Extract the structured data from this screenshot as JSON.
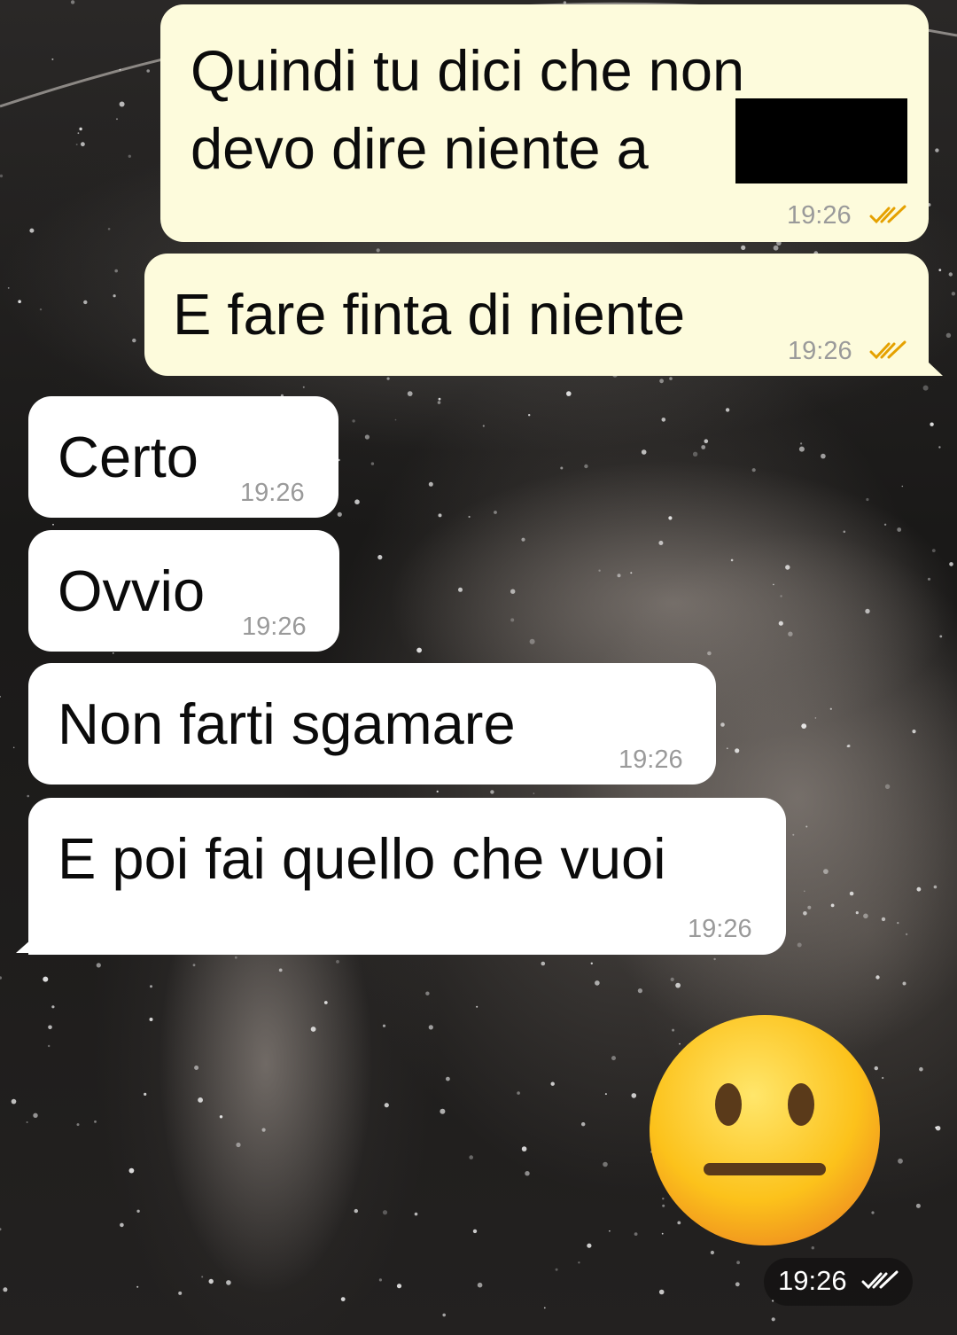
{
  "theme": {
    "outgoing_bubble_color": "#fdfbdc",
    "incoming_bubble_color": "#ffffff",
    "read_ticks_color": "#e5a100",
    "time_color": "#9a9a9a"
  },
  "messages": [
    {
      "direction": "outgoing",
      "lines": [
        "Quindi tu dici che non",
        "devo dire niente a"
      ],
      "redacted": true,
      "time": "19:26",
      "status_icon": "double-check-read-icon"
    },
    {
      "direction": "outgoing",
      "text": "E fare finta di niente",
      "time": "19:26",
      "status_icon": "double-check-read-icon"
    },
    {
      "direction": "incoming",
      "text": "Certo",
      "time": "19:26"
    },
    {
      "direction": "incoming",
      "text": "Ovvio",
      "time": "19:26"
    },
    {
      "direction": "incoming",
      "text": "Non farti sgamare",
      "time": "19:26"
    },
    {
      "direction": "incoming",
      "text": "E poi fai quello che vuoi",
      "time": "19:26"
    },
    {
      "direction": "outgoing",
      "emoji": "neutral-face-emoji",
      "time": "19:26",
      "status_icon": "double-check-delivered-icon"
    }
  ]
}
